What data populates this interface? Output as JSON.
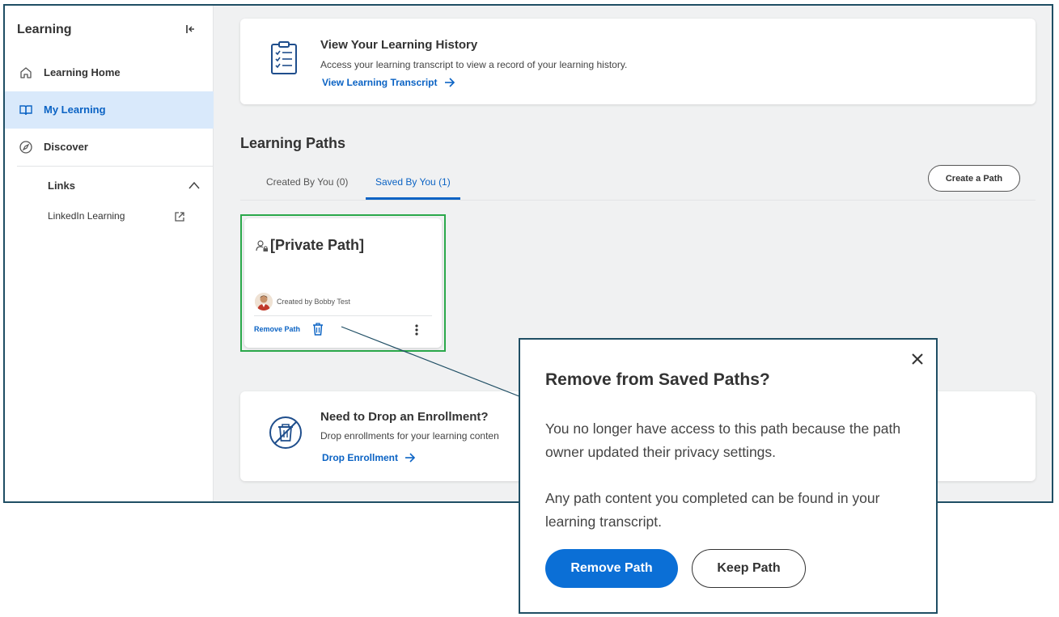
{
  "sidebar": {
    "title": "Learning",
    "items": [
      {
        "label": "Learning Home",
        "icon": "home-icon"
      },
      {
        "label": "My Learning",
        "icon": "book-icon",
        "active": true
      },
      {
        "label": "Discover",
        "icon": "compass-icon"
      }
    ],
    "links": {
      "heading": "Links",
      "items": [
        {
          "label": "LinkedIn Learning",
          "icon": "external-link-icon"
        }
      ]
    }
  },
  "history_card": {
    "title": "View Your Learning History",
    "description": "Access your learning transcript to view a record of your learning history.",
    "link": "View Learning Transcript"
  },
  "learning_paths": {
    "title": "Learning Paths",
    "tabs": [
      {
        "label": "Created By You (0)"
      },
      {
        "label": "Saved By You (1)",
        "active": true
      }
    ],
    "create_button": "Create a Path",
    "path_card": {
      "title": "[Private Path]",
      "created_by": "Created by Bobby Test",
      "remove_label": "Remove Path"
    }
  },
  "drop_card": {
    "title": "Need to Drop an Enrollment?",
    "description": "Drop enrollments for your learning conten",
    "link": "Drop Enrollment"
  },
  "dialog": {
    "title": "Remove from Saved Paths?",
    "paragraph1": "You no longer have access to this path because the path owner updated their privacy settings.",
    "paragraph2": "Any path content you completed can be found in your learning transcript.",
    "primary_button": "Remove Path",
    "secondary_button": "Keep Path"
  },
  "colors": {
    "accent": "#0b63c4",
    "highlight_border": "#2aa84a",
    "frame_border": "#1f4e64",
    "active_bg": "#d9e9fb"
  }
}
